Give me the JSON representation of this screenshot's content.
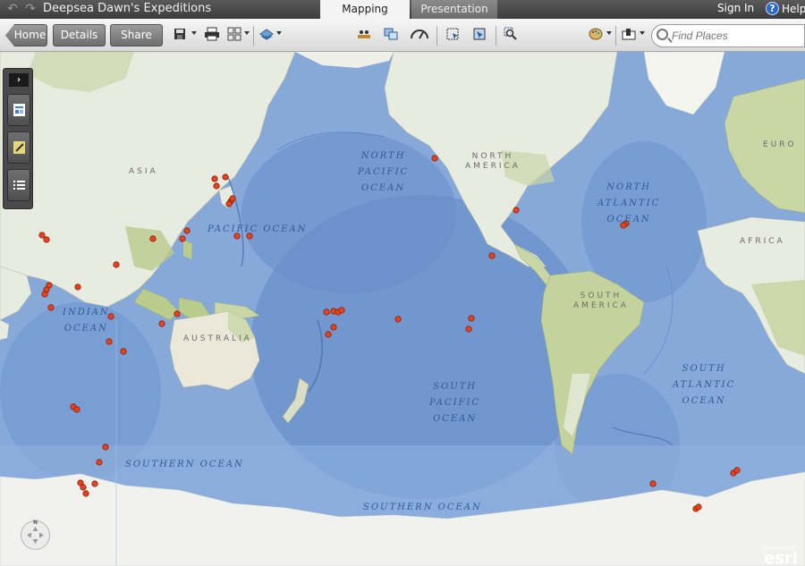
{
  "header": {
    "title": "Deepsea Dawn's Expeditions",
    "tabs": [
      {
        "label": "Mapping",
        "active": true
      },
      {
        "label": "Presentation",
        "active": false
      }
    ],
    "sign_in": "Sign In",
    "help": "Help"
  },
  "toolbar": {
    "home": "Home",
    "details": "Details",
    "share": "Share",
    "search_placeholder": "Find Places",
    "icons": [
      "save-icon",
      "print-icon",
      "layout-icon",
      "basemap-icon",
      "measure-icon",
      "overlap-icon",
      "gauge-icon",
      "select-icon",
      "zoom-rect-icon",
      "zoom-search-icon",
      "palette-icon",
      "bookmark-icon"
    ]
  },
  "map": {
    "ocean_labels": {
      "north_pacific": "NORTH\nPACIFIC\nOCEAN",
      "pacific": "PACIFIC OCEAN",
      "north_atlantic": "NORTH\nATLANTIC\nOCEAN",
      "indian": "INDIAN\nOCEAN",
      "south_pacific": "SOUTH\nPACIFIC\nOCEAN",
      "south_atlantic": "SOUTH\nATLANTIC\nOCEAN",
      "southern_1": "SOUTHERN OCEAN",
      "southern_2": "SOUTHERN OCEAN"
    },
    "land_labels": {
      "asia": "ASIA",
      "north_america": "NORTH\nAMERICA",
      "europe": "EURO",
      "africa": "AFRICA",
      "south_america": "SOUTH\nAMERICA",
      "australia": "AUSTRALIA"
    },
    "pan_north": "N",
    "attribution_powered": "POWERED BY",
    "attribution_logo": "esri",
    "colors": {
      "ocean": "#7fa4d6",
      "land": "#e9ecdf",
      "marker": "#e8431c",
      "marker_stroke": "#8a1e06"
    }
  },
  "side_panel": {
    "items": [
      "legend-icon",
      "edit-icon",
      "contents-icon"
    ]
  }
}
